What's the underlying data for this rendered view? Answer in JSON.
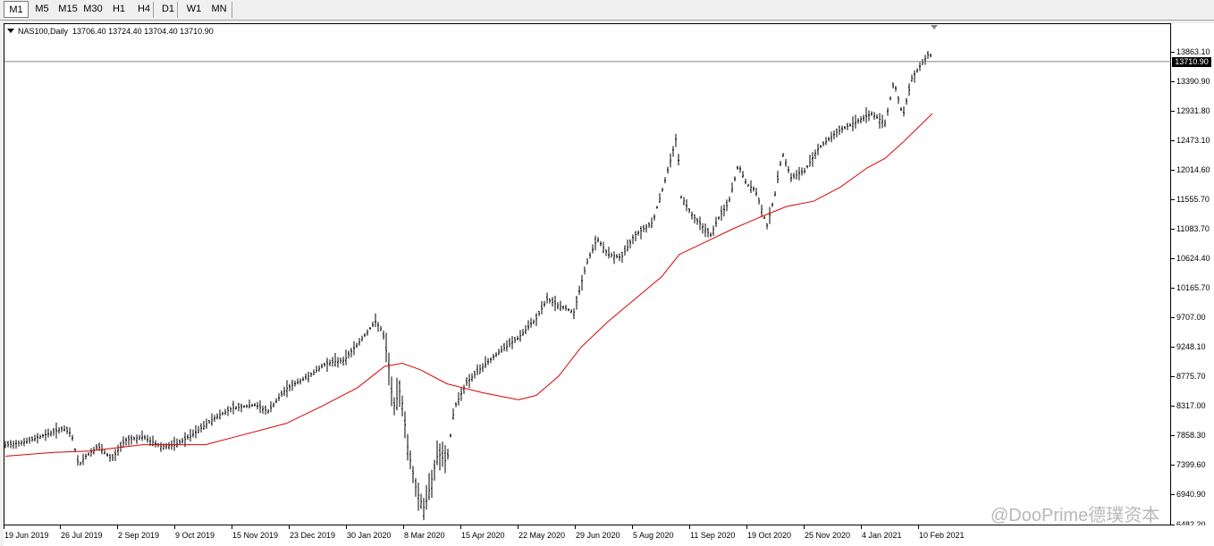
{
  "toolbar": {
    "timeframes": [
      "M1",
      "M5",
      "M15",
      "M30",
      "H1",
      "H4",
      "D1",
      "W1",
      "MN"
    ],
    "active": "M1"
  },
  "header": {
    "symbol": "NAS100,Daily",
    "ohlc": "13706.40 13724.40 13704.40 13710.90"
  },
  "price_axis": {
    "labels": [
      "13863.10",
      "13390.90",
      "12931.80",
      "12473.10",
      "12014.60",
      "11555.70",
      "11083.70",
      "10624.40",
      "10165.70",
      "9707.00",
      "9248.10",
      "8775.70",
      "8317.00",
      "7858.30",
      "7399.60",
      "6940.90",
      "6482.20"
    ],
    "current_price": "13710.90"
  },
  "time_axis": {
    "labels": [
      "19 Jun 2019",
      "26 Jul 2019",
      "2 Sep 2019",
      "9 Oct 2019",
      "15 Nov 2019",
      "23 Dec 2019",
      "30 Jan 2020",
      "8 Mar 2020",
      "15 Apr 2020",
      "22 May 2020",
      "29 Jun 2020",
      "5 Aug 2020",
      "11 Sep 2020",
      "19 Oct 2020",
      "25 Nov 2020",
      "4 Jan 2021",
      "10 Feb 2021"
    ]
  },
  "watermark": "@DooPrime德璞资本",
  "colors": {
    "ma_line": "#dc0000",
    "bars": "#000000",
    "current_price_line": "#808080"
  },
  "chart_data": {
    "type": "line",
    "series": [
      {
        "name": "",
        "style": "ohlc-bars",
        "x": [
          "19 Jun 2019",
          "26 Jul 2019",
          "2 Sep 2019",
          "9 Oct 2019",
          "15 Nov 2019",
          "23 Dec 2019",
          "30 Jan 2020",
          "8 Mar 2020",
          "15 Apr 2020",
          "22 May 2020",
          "29 Jun 2020",
          "5 Aug 2020",
          "11 Sep 2020",
          "19 Oct 2020",
          "25 Nov 2020",
          "4 Jan 2021",
          "10 Feb 2021"
        ],
        "close": [
          7700,
          7900,
          7580,
          7720,
          8310,
          8700,
          9100,
          7900,
          8650,
          9420,
          10100,
          11150,
          11250,
          11550,
          12200,
          12950,
          13710
        ]
      },
      {
        "name": "",
        "style": "moving-average",
        "x": [
          "19 Jun 2019",
          "26 Jul 2019",
          "2 Sep 2019",
          "9 Oct 2019",
          "15 Nov 2019",
          "23 Dec 2019",
          "30 Jan 2020",
          "8 Mar 2020",
          "15 Apr 2020",
          "22 May 2020",
          "29 Jun 2020",
          "5 Aug 2020",
          "11 Sep 2020",
          "19 Oct 2020",
          "25 Nov 2020",
          "4 Jan 2021",
          "10 Feb 2021"
        ],
        "values": [
          7550,
          7610,
          7720,
          7730,
          7920,
          8190,
          8580,
          8980,
          8640,
          8450,
          8830,
          9870,
          10900,
          11380,
          11600,
          12240,
          12950
        ]
      }
    ],
    "ylim": [
      6482.2,
      14100
    ],
    "last": {
      "open": 13706.4,
      "high": 13724.4,
      "low": 13704.4,
      "close": 13710.9
    }
  }
}
